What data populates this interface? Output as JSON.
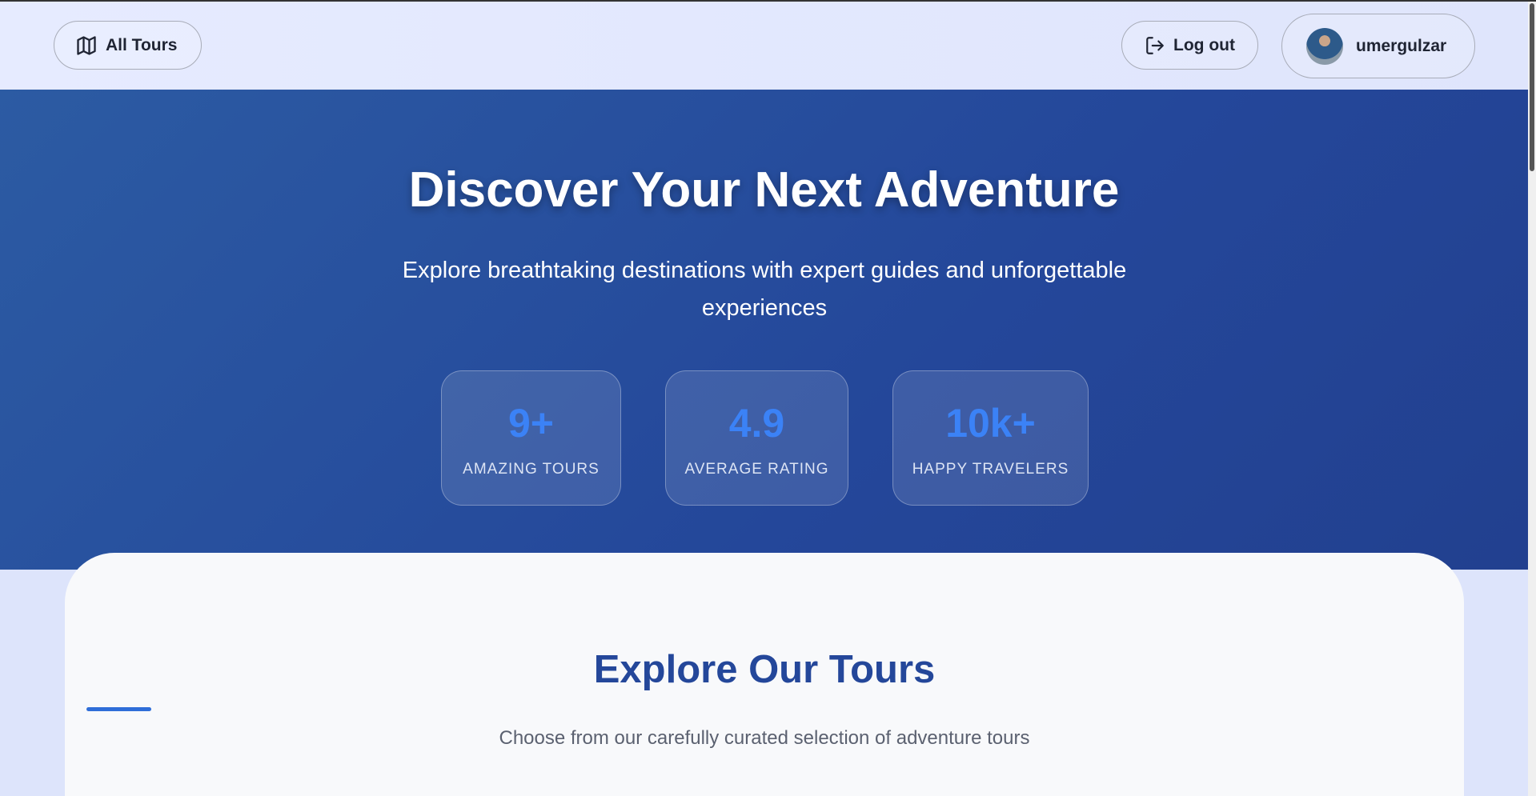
{
  "nav": {
    "all_tours": "All Tours",
    "logout": "Log out",
    "username": "umergulzar"
  },
  "hero": {
    "title": "Discover Your Next Adventure",
    "subtitle": "Explore breathtaking destinations with expert guides and unforgettable experiences",
    "stats": [
      {
        "value": "9+",
        "label": "AMAZING TOURS"
      },
      {
        "value": "4.9",
        "label": "AVERAGE RATING"
      },
      {
        "value": "10k+",
        "label": "HAPPY TRAVELERS"
      }
    ]
  },
  "section": {
    "title": "Explore Our Tours",
    "subtitle": "Choose from our carefully curated selection of adventure tours"
  },
  "colors": {
    "accent": "#3b82f6",
    "hero": "#24479a"
  }
}
